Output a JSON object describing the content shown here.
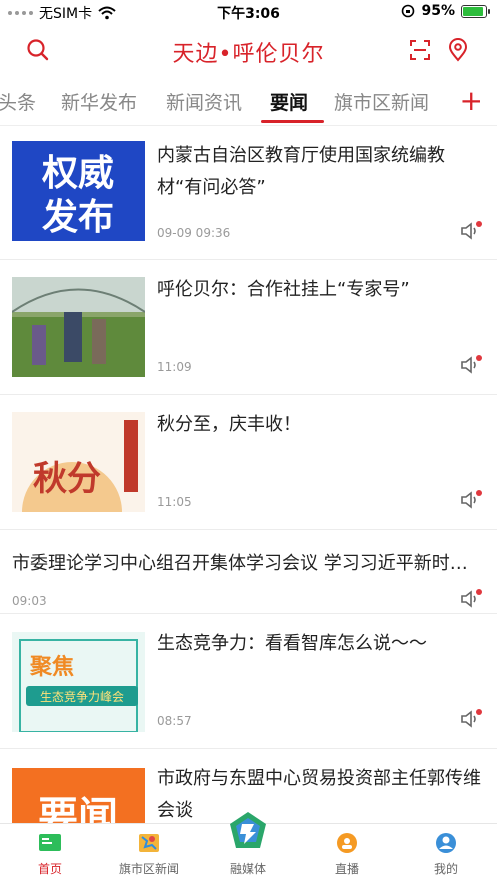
{
  "status_bar": {
    "carrier": "无SIM卡",
    "time": "下午3:06",
    "battery": "95%"
  },
  "header": {
    "title": "天边•呼伦贝尔"
  },
  "tabs": [
    {
      "label": "头条"
    },
    {
      "label": "新华发布"
    },
    {
      "label": "新闻资讯"
    },
    {
      "label": "要闻",
      "active": true
    },
    {
      "label": "旗市区新闻"
    }
  ],
  "tabs_add": "+",
  "news": [
    {
      "title": "内蒙古自治区教育厅使用国家统编教材“有问必答”",
      "time": "09-09 09:36",
      "thumb_text": [
        "权威",
        "发布"
      ]
    },
    {
      "title": "呼伦贝尔：合作社挂上“专家号”",
      "time": "11:09"
    },
    {
      "title": "秋分至，庆丰收！",
      "time": "11:05",
      "thumb_text": [
        "秋分"
      ]
    },
    {
      "title": "市委理论学习中心组召开集体学习会议 学习习近平新时代中国特色社会主义思想",
      "time": "09:03"
    },
    {
      "title": "生态竞争力：看看智库怎么说～～",
      "time": "08:57",
      "thumb_text": [
        "聚焦",
        "生态竞争力峰会"
      ]
    },
    {
      "title": "市政府与东盟中心贸易投资部主任郭传维会谈",
      "time": "",
      "thumb_text": [
        "要闻"
      ]
    }
  ],
  "tabbar": [
    {
      "label": "首页",
      "active": true
    },
    {
      "label": "旗市区新闻"
    },
    {
      "label": "融媒体"
    },
    {
      "label": "直播"
    },
    {
      "label": "我的"
    }
  ],
  "colors": {
    "accent": "#d8232a",
    "muted": "#9a9a9a"
  }
}
